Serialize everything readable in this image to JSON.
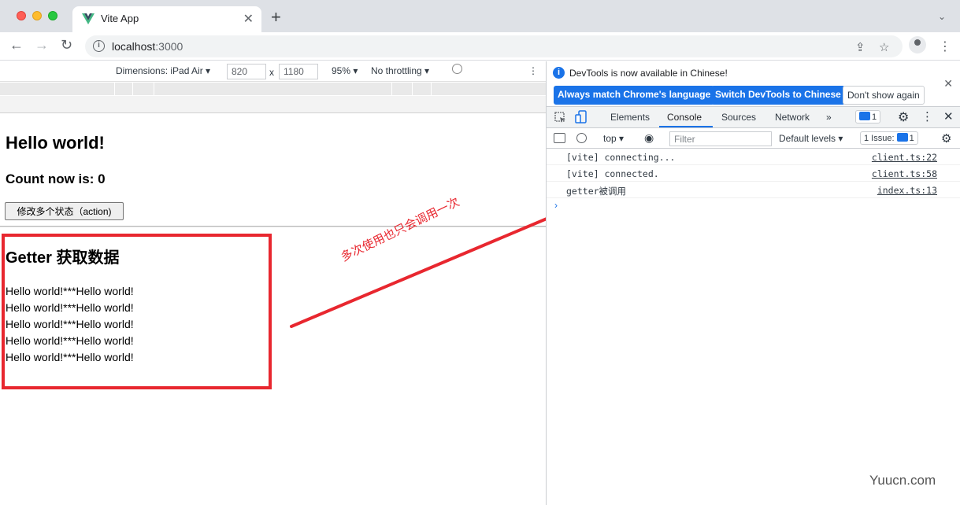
{
  "browser": {
    "tab_title": "Vite App",
    "tab_close": "✕",
    "new_tab": "+",
    "tab_search": "⌄",
    "url_host": "localhost",
    "url_port": ":3000",
    "nav": {
      "back": "←",
      "forward": "→",
      "reload": "↻"
    },
    "info": "i",
    "share": "⇪",
    "star": "☆",
    "menu": "⋮"
  },
  "device_toolbar": {
    "dimensions_label": "Dimensions: iPad Air ▾",
    "width": "820",
    "times": "x",
    "height": "1180",
    "zoom": "95% ▾",
    "throttling": "No throttling ▾",
    "rotate": "⃠",
    "more": "⋮"
  },
  "page": {
    "title": "Hello world!",
    "count_text": "Count now is: 0",
    "action_button": "修改多个状态（action)",
    "getter_heading": "Getter 获取数据",
    "getter_lines": [
      "Hello world!***Hello world!",
      "Hello world!***Hello world!",
      "Hello world!***Hello world!",
      "Hello world!***Hello world!",
      "Hello world!***Hello world!"
    ]
  },
  "annotation": {
    "note": "多次使用也只会调用一次",
    "color": "#e8272f"
  },
  "devtools": {
    "info_icon": "i",
    "info_message": "DevTools is now available in Chinese!",
    "info_close": "✕",
    "buttons": {
      "match_language": "Always match Chrome's language",
      "switch_chinese": "Switch DevTools to Chinese",
      "dont_show": "Don't show again"
    },
    "tabs": [
      "Elements",
      "Console",
      "Sources",
      "Network",
      "»"
    ],
    "active_tab": "Console",
    "messages_badge": "1",
    "console_bar": {
      "context": "top ▾",
      "filter_placeholder": "Filter",
      "levels": "Default levels ▾",
      "issues": "1 Issue:",
      "issues_count": "1"
    },
    "logs": [
      {
        "message": "[vite] connecting...",
        "source": "client.ts:22"
      },
      {
        "message": "[vite] connected.",
        "source": "client.ts:58"
      },
      {
        "message": "getter被调用",
        "source": "index.ts:13"
      }
    ],
    "prompt": "›"
  },
  "watermark": "Yuucn.com"
}
